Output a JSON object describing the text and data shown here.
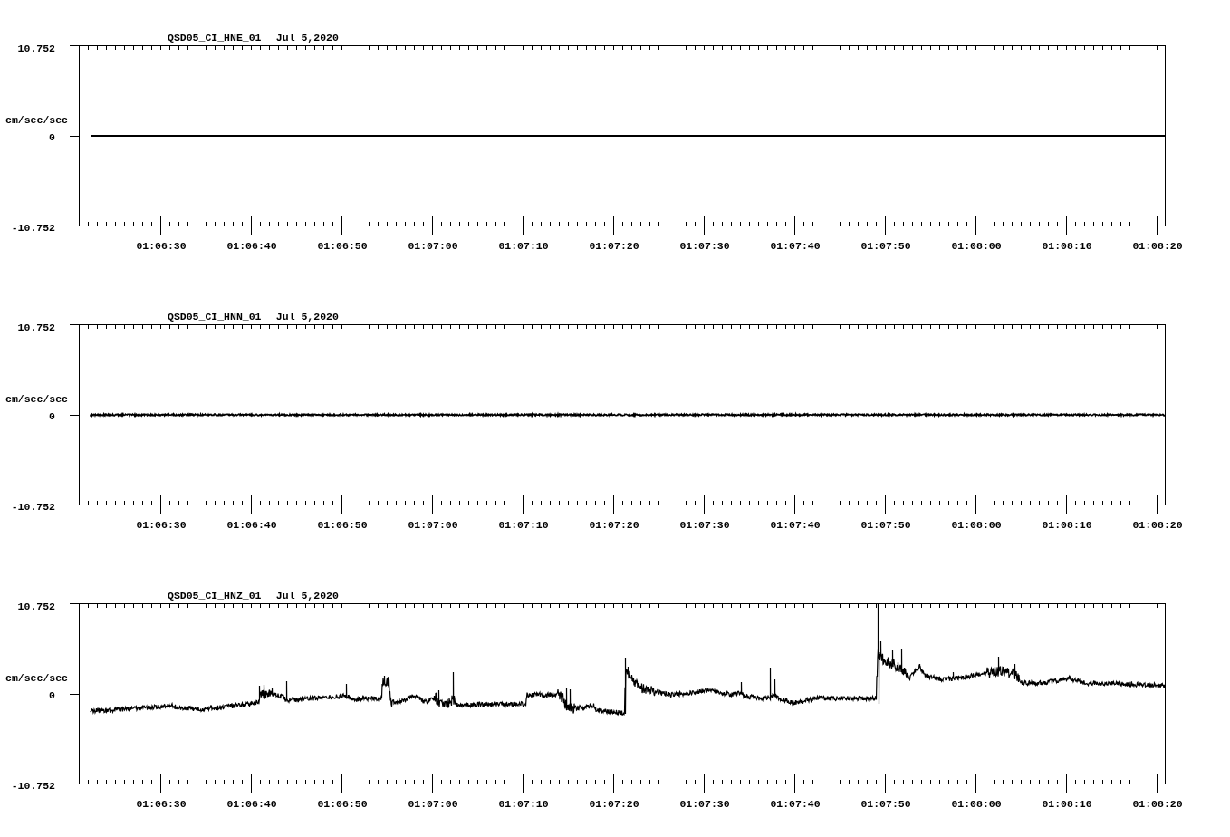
{
  "panels": [
    {
      "kind": "flat",
      "title": "QSD05_CI_HNE_01",
      "date": "Jul 5,2020",
      "unit": "cm/sec/sec",
      "y_tick_labels": [
        "10.752",
        "0",
        "-10.752"
      ],
      "x_tick_labels": [
        "01:06:30",
        "01:06:40",
        "01:06:50",
        "01:07:00",
        "01:07:10",
        "01:07:20",
        "01:07:30",
        "01:07:40",
        "01:07:50",
        "01:08:00",
        "01:08:10",
        "01:08:20"
      ]
    },
    {
      "kind": "noise",
      "title": "QSD05_CI_HNN_01",
      "date": "Jul 5,2020",
      "unit": "cm/sec/sec",
      "y_tick_labels": [
        "10.752",
        "0",
        "-10.752"
      ],
      "x_tick_labels": [
        "01:06:30",
        "01:06:40",
        "01:06:50",
        "01:07:00",
        "01:07:10",
        "01:07:20",
        "01:07:30",
        "01:07:40",
        "01:07:50",
        "01:08:00",
        "01:08:10",
        "01:08:20"
      ]
    },
    {
      "kind": "event",
      "title": "QSD05_CI_HNZ_01",
      "date": "Jul 5,2020",
      "unit": "cm/sec/sec",
      "y_tick_labels": [
        "10.752",
        "0",
        "-10.752"
      ],
      "x_tick_labels": [
        "01:06:30",
        "01:06:40",
        "01:06:50",
        "01:07:00",
        "01:07:10",
        "01:07:20",
        "01:07:30",
        "01:07:40",
        "01:07:50",
        "01:08:00",
        "01:08:10",
        "01:08:20"
      ]
    }
  ]
}
